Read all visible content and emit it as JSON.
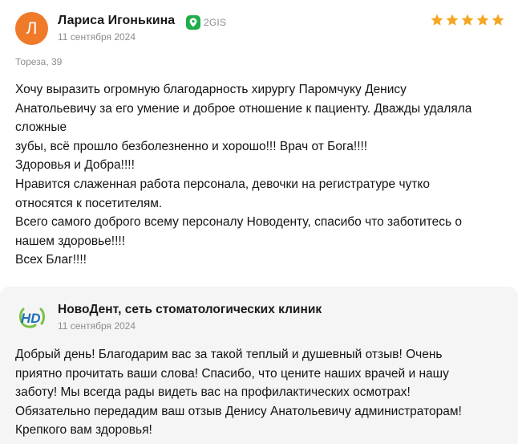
{
  "review": {
    "avatar_letter": "Л",
    "avatar_color": "#ef7a2a",
    "author": "Лариса Игонькина",
    "source": "2GIS",
    "source_icon": "2gis-pin-icon",
    "date": "11 сентября 2024",
    "rating": 5,
    "rating_max": 5,
    "star_color": "#f5a623",
    "location": "Тореза, 39",
    "text_lines": [
      "Хочу выразить огромную благодарность хирургу Паромчуку Денису",
      "Анатольевичу за его умение и доброе отношение к пациенту. Дважды удаляла",
      "сложные",
      "зубы, всё прошло безболезненно и хорошо!!! Врач от Бога!!!!",
      "Здоровья и Добра!!!!",
      "Нравится слаженная работа персонала, девочки на регистратуре чутко",
      "относятся к посетителям.",
      "Всего самого доброго всему персоналу Новоденту, спасибо что заботитесь о",
      "нашем здоровье!!!!",
      "Всех Благ!!!!"
    ]
  },
  "reply": {
    "org_name": "НовоДент, сеть стоматологических клиник",
    "org_logo": "novodent-logo-icon",
    "date": "11 сентября 2024",
    "text_lines": [
      "Добрый день! Благодарим вас за такой теплый и душевный отзыв! Очень",
      "приятно прочитать ваши слова! Спасибо, что цените наших врачей и нашу",
      "заботу! Мы всегда рады видеть вас на профилактических осмотрах!",
      "Обязательно передадим ваш отзыв Денису Анатольевичу администраторам!",
      "Крепкого вам здоровья!"
    ]
  }
}
